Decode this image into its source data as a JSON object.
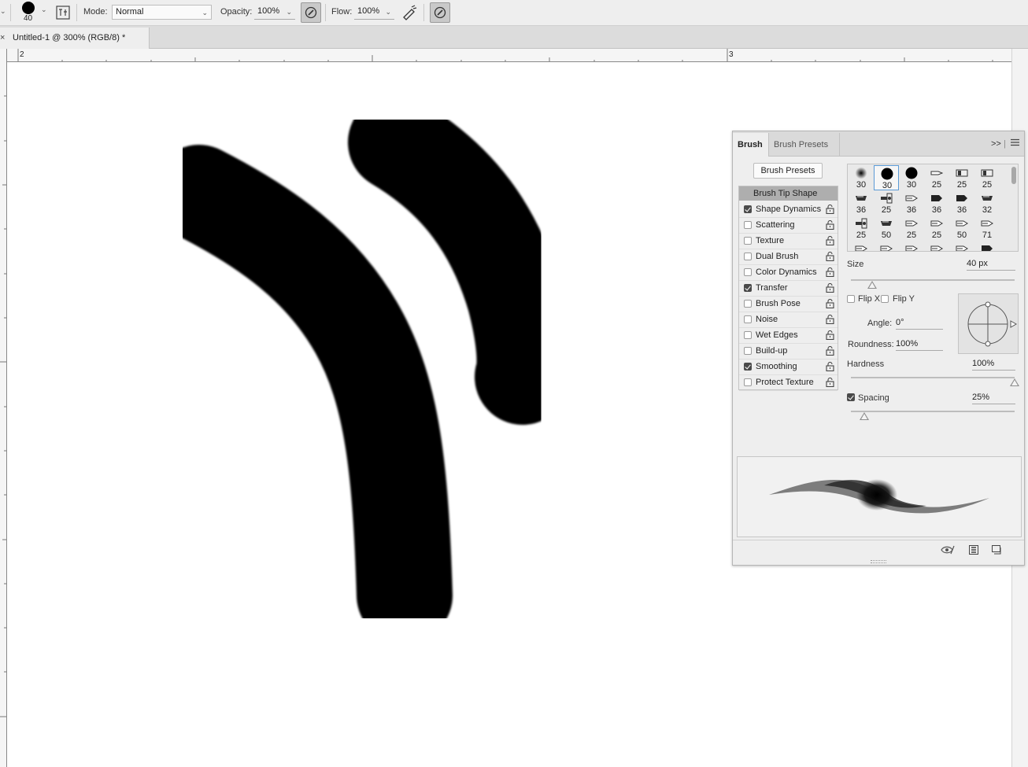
{
  "options_bar": {
    "brush_size": "40",
    "mode_label": "Mode:",
    "mode_value": "Normal",
    "opacity_label": "Opacity:",
    "opacity_value": "100%",
    "flow_label": "Flow:",
    "flow_value": "100%"
  },
  "document": {
    "tab_close": "×",
    "tab_title": "Untitled-1 @ 300% (RGB/8) *",
    "ruler_labels": [
      "2",
      "3"
    ]
  },
  "brush_panel": {
    "tabs": [
      "Brush",
      "Brush Presets"
    ],
    "expand_glyph": ">>",
    "presets_button": "Brush Presets",
    "options_header": "Brush Tip Shape",
    "options": [
      {
        "label": "Shape Dynamics",
        "checked": true
      },
      {
        "label": "Scattering",
        "checked": false
      },
      {
        "label": "Texture",
        "checked": false
      },
      {
        "label": "Dual Brush",
        "checked": false
      },
      {
        "label": "Color Dynamics",
        "checked": false
      },
      {
        "label": "Transfer",
        "checked": true
      },
      {
        "label": "Brush Pose",
        "checked": false
      },
      {
        "label": "Noise",
        "checked": false
      },
      {
        "label": "Wet Edges",
        "checked": false
      },
      {
        "label": "Build-up",
        "checked": false
      },
      {
        "label": "Smoothing",
        "checked": true
      },
      {
        "label": "Protect Texture",
        "checked": false
      }
    ],
    "tips": [
      {
        "size": "30",
        "icon": "soft-round-tip-icon"
      },
      {
        "size": "30",
        "icon": "hard-round-tip-icon",
        "selected": true
      },
      {
        "size": "30",
        "icon": "hard-round-tip-icon"
      },
      {
        "size": "25",
        "icon": "pencil-tip-icon"
      },
      {
        "size": "25",
        "icon": "marker-tip-icon"
      },
      {
        "size": "25",
        "icon": "marker-tip-icon"
      },
      {
        "size": "36",
        "icon": "chisel-tip-icon"
      },
      {
        "size": "25",
        "icon": "airbrush-tip-icon"
      },
      {
        "size": "36",
        "icon": "bristle-tip-icon"
      },
      {
        "size": "36",
        "icon": "flat-tip-icon"
      },
      {
        "size": "36",
        "icon": "flat-tip-icon"
      },
      {
        "size": "32",
        "icon": "chisel-tip-icon"
      },
      {
        "size": "25",
        "icon": "airbrush-tip-icon"
      },
      {
        "size": "50",
        "icon": "chisel-tip-icon"
      },
      {
        "size": "25",
        "icon": "bristle-tip-icon"
      },
      {
        "size": "25",
        "icon": "bristle-tip-icon"
      },
      {
        "size": "50",
        "icon": "bristle-tip-icon"
      },
      {
        "size": "71",
        "icon": "bristle-tip-icon"
      },
      {
        "size": "",
        "icon": "bristle-tip-icon"
      },
      {
        "size": "",
        "icon": "bristle-tip-icon"
      },
      {
        "size": "",
        "icon": "bristle-tip-icon"
      },
      {
        "size": "",
        "icon": "bristle-tip-icon"
      },
      {
        "size": "",
        "icon": "bristle-tip-icon"
      },
      {
        "size": "",
        "icon": "flat-tip-icon"
      }
    ],
    "size_label": "Size",
    "size_value": "40 px",
    "size_level": 0.13,
    "flip_x": "Flip X",
    "flip_y": "Flip Y",
    "angle_label": "Angle:",
    "angle_value": "0°",
    "roundness_label": "Roundness:",
    "roundness_value": "100%",
    "hardness_label": "Hardness",
    "hardness_value": "100%",
    "hardness_level": 1.0,
    "spacing_label": "Spacing",
    "spacing_value": "25%",
    "spacing_checked": true,
    "spacing_level": 0.08
  },
  "colors": {
    "accent": "#5a9ad6",
    "stroke": "#000000",
    "panel_bg": "#eeeeee"
  }
}
